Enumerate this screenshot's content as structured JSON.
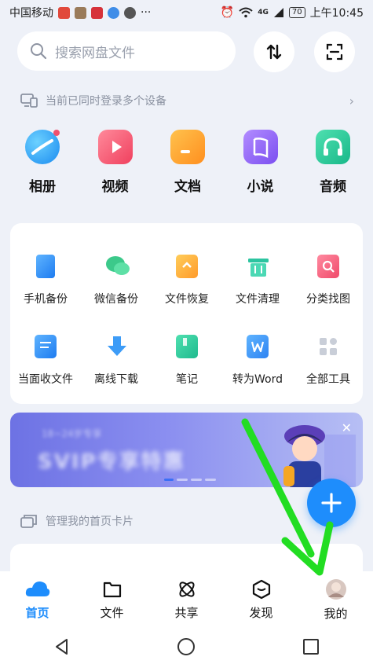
{
  "status_bar": {
    "carrier": "中国移动",
    "more": "···",
    "network": "4G",
    "battery": "70",
    "time": "上午10:45"
  },
  "search": {
    "placeholder": "搜索网盘文件"
  },
  "notice": {
    "text": "当前已同时登录多个设备"
  },
  "categories": [
    {
      "label": "相册",
      "icon": "album-icon"
    },
    {
      "label": "视频",
      "icon": "video-icon"
    },
    {
      "label": "文档",
      "icon": "document-icon"
    },
    {
      "label": "小说",
      "icon": "novel-icon"
    },
    {
      "label": "音频",
      "icon": "audio-icon"
    }
  ],
  "tools": [
    {
      "label": "手机备份",
      "icon": "phone-backup-icon"
    },
    {
      "label": "微信备份",
      "icon": "wechat-backup-icon"
    },
    {
      "label": "文件恢复",
      "icon": "file-restore-icon"
    },
    {
      "label": "文件清理",
      "icon": "file-cleanup-icon"
    },
    {
      "label": "分类找图",
      "icon": "image-search-icon"
    },
    {
      "label": "当面收文件",
      "icon": "receive-file-icon"
    },
    {
      "label": "离线下载",
      "icon": "offline-download-icon"
    },
    {
      "label": "笔记",
      "icon": "notes-icon"
    },
    {
      "label": "转为Word",
      "icon": "word-convert-icon"
    },
    {
      "label": "全部工具",
      "icon": "all-tools-icon"
    }
  ],
  "banner": {
    "line1": "18~24岁专享",
    "line2": "SVIP专享特惠"
  },
  "manage": {
    "text": "管理我的首页卡片"
  },
  "nav": [
    {
      "label": "首页",
      "icon": "home-icon",
      "active": true
    },
    {
      "label": "文件",
      "icon": "folder-icon",
      "active": false
    },
    {
      "label": "共享",
      "icon": "share-icon",
      "active": false
    },
    {
      "label": "发现",
      "icon": "discover-icon",
      "active": false
    },
    {
      "label": "我的",
      "icon": "avatar",
      "active": false
    }
  ],
  "colors": {
    "accent": "#1e8dfc",
    "annotation": "#22dd22"
  }
}
